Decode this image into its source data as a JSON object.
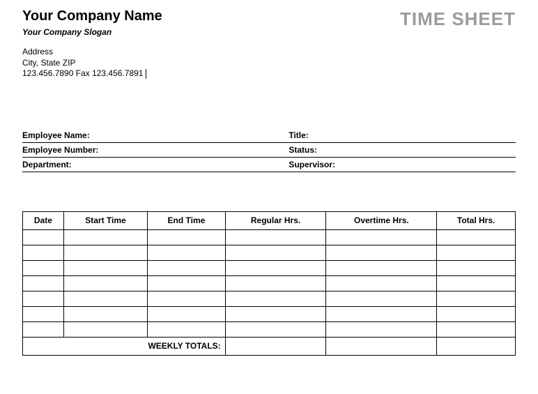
{
  "header": {
    "company_name": "Your Company Name",
    "slogan": "Your Company Slogan",
    "doc_title": "TIME SHEET",
    "address_line1": "Address",
    "address_line2": "City, State ZIP",
    "address_line3": "123.456.7890   Fax 123.456.7891"
  },
  "info": {
    "employee_name_label": "Employee Name:",
    "title_label": "Title:",
    "employee_number_label": "Employee Number:",
    "status_label": "Status:",
    "department_label": "Department:",
    "supervisor_label": "Supervisor:"
  },
  "table": {
    "headers": {
      "date": "Date",
      "start": "Start Time",
      "end": "End Time",
      "regular": "Regular Hrs.",
      "overtime": "Overtime Hrs.",
      "total": "Total Hrs."
    },
    "weekly_totals_label": "WEEKLY TOTALS:"
  }
}
